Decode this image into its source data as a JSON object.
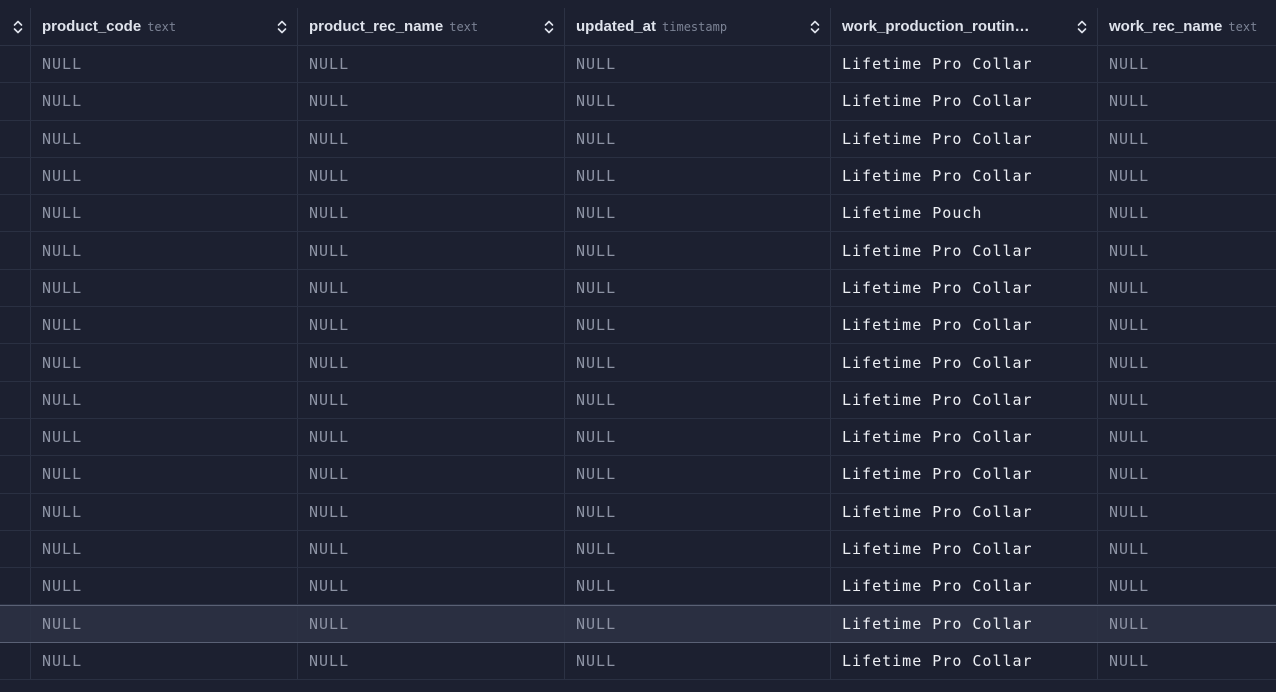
{
  "columns": [
    {
      "name": "",
      "type": ""
    },
    {
      "name": "product_code",
      "type": "text"
    },
    {
      "name": "product_rec_name",
      "type": "text"
    },
    {
      "name": "updated_at",
      "type": "timestamp"
    },
    {
      "name": "work_production_routin…",
      "type": ""
    },
    {
      "name": "work_rec_name",
      "type": "text"
    }
  ],
  "rows": [
    [
      "NULL",
      "NULL",
      "NULL",
      "Lifetime Pro Collar",
      "NULL"
    ],
    [
      "NULL",
      "NULL",
      "NULL",
      "Lifetime Pro Collar",
      "NULL"
    ],
    [
      "NULL",
      "NULL",
      "NULL",
      "Lifetime Pro Collar",
      "NULL"
    ],
    [
      "NULL",
      "NULL",
      "NULL",
      "Lifetime Pro Collar",
      "NULL"
    ],
    [
      "NULL",
      "NULL",
      "NULL",
      "Lifetime Pouch",
      "NULL"
    ],
    [
      "NULL",
      "NULL",
      "NULL",
      "Lifetime Pro Collar",
      "NULL"
    ],
    [
      "NULL",
      "NULL",
      "NULL",
      "Lifetime Pro Collar",
      "NULL"
    ],
    [
      "NULL",
      "NULL",
      "NULL",
      "Lifetime Pro Collar",
      "NULL"
    ],
    [
      "NULL",
      "NULL",
      "NULL",
      "Lifetime Pro Collar",
      "NULL"
    ],
    [
      "NULL",
      "NULL",
      "NULL",
      "Lifetime Pro Collar",
      "NULL"
    ],
    [
      "NULL",
      "NULL",
      "NULL",
      "Lifetime Pro Collar",
      "NULL"
    ],
    [
      "NULL",
      "NULL",
      "NULL",
      "Lifetime Pro Collar",
      "NULL"
    ],
    [
      "NULL",
      "NULL",
      "NULL",
      "Lifetime Pro Collar",
      "NULL"
    ],
    [
      "NULL",
      "NULL",
      "NULL",
      "Lifetime Pro Collar",
      "NULL"
    ],
    [
      "NULL",
      "NULL",
      "NULL",
      "Lifetime Pro Collar",
      "NULL"
    ],
    [
      "NULL",
      "NULL",
      "NULL",
      "Lifetime Pro Collar",
      "NULL"
    ],
    [
      "NULL",
      "NULL",
      "NULL",
      "Lifetime Pro Collar",
      "NULL"
    ]
  ],
  "selected_row": 15,
  "icons": {
    "sort": "sort-icon"
  },
  "colors": {
    "background": "#1c2030",
    "grid_line": "#2c3244",
    "selected_row": "#2a2f41",
    "null_text": "#8c92a3",
    "value_text": "#eceef3"
  }
}
